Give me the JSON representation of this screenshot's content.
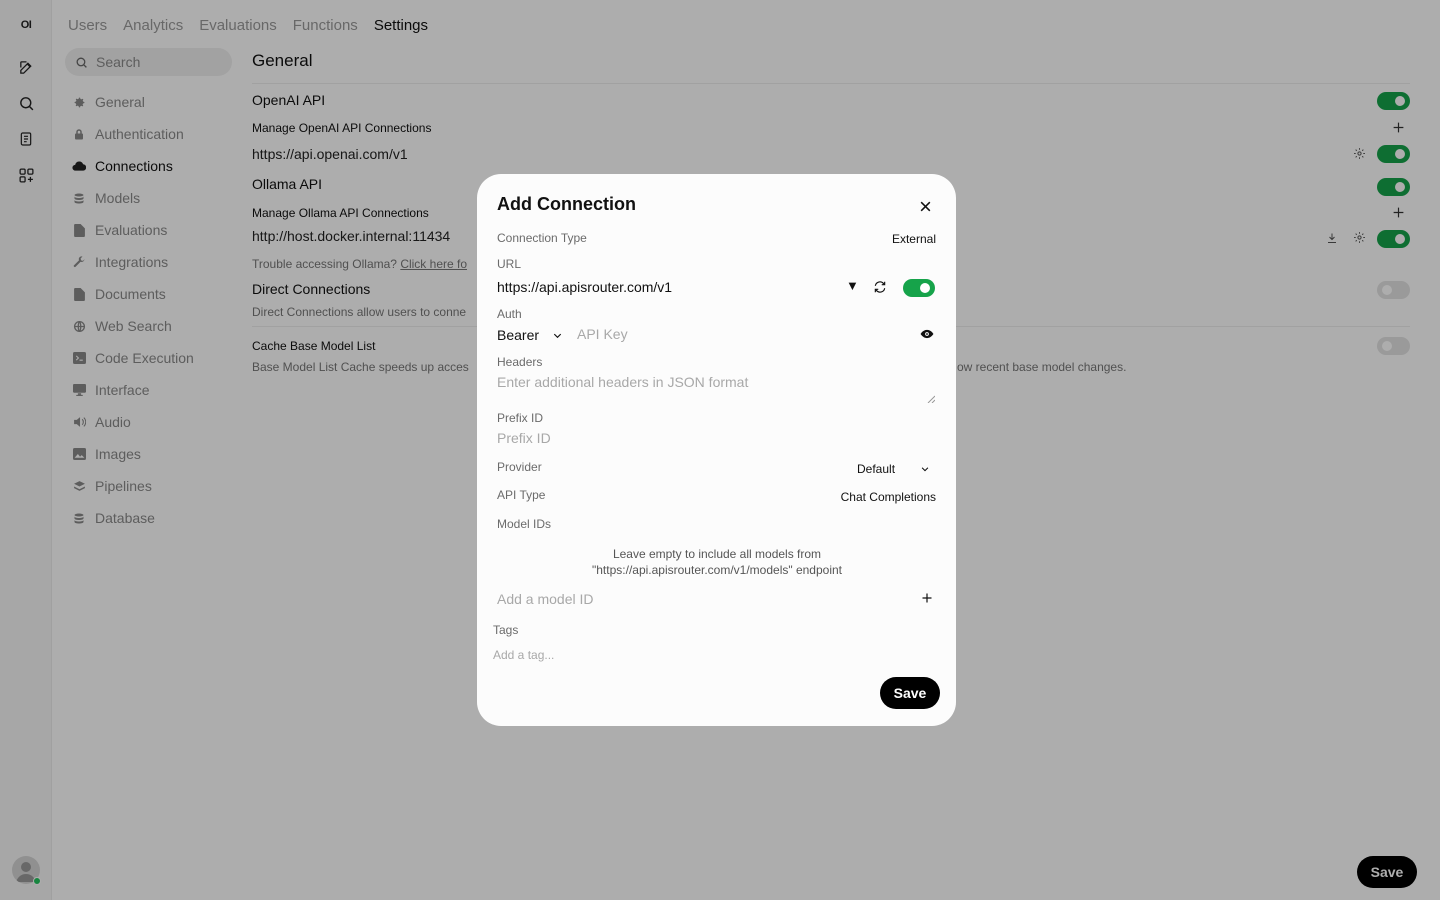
{
  "rail": {
    "logo": "OI",
    "icons": [
      "new-chat-icon",
      "search-icon",
      "notes-icon",
      "workspace-icon"
    ]
  },
  "top_tabs": [
    {
      "label": "Users",
      "active": false
    },
    {
      "label": "Analytics",
      "active": false
    },
    {
      "label": "Evaluations",
      "active": false
    },
    {
      "label": "Functions",
      "active": false
    },
    {
      "label": "Settings",
      "active": true
    }
  ],
  "sidebar": {
    "search_placeholder": "Search",
    "items": [
      {
        "label": "General",
        "icon": "gear-icon",
        "active": false
      },
      {
        "label": "Authentication",
        "icon": "lock-icon",
        "active": false
      },
      {
        "label": "Connections",
        "icon": "cloud-icon",
        "active": true
      },
      {
        "label": "Models",
        "icon": "stack-icon",
        "active": false
      },
      {
        "label": "Evaluations",
        "icon": "document-icon",
        "active": false
      },
      {
        "label": "Integrations",
        "icon": "wrench-icon",
        "active": false
      },
      {
        "label": "Documents",
        "icon": "document-icon",
        "active": false
      },
      {
        "label": "Web Search",
        "icon": "globe-icon",
        "active": false
      },
      {
        "label": "Code Execution",
        "icon": "terminal-icon",
        "active": false
      },
      {
        "label": "Interface",
        "icon": "monitor-icon",
        "active": false
      },
      {
        "label": "Audio",
        "icon": "speaker-icon",
        "active": false
      },
      {
        "label": "Images",
        "icon": "image-icon",
        "active": false
      },
      {
        "label": "Pipelines",
        "icon": "layers-icon",
        "active": false
      },
      {
        "label": "Database",
        "icon": "database-icon",
        "active": false
      }
    ]
  },
  "main": {
    "title": "General",
    "openai": {
      "title": "OpenAI API",
      "manage_label": "Manage OpenAI API Connections",
      "url": "https://api.openai.com/v1",
      "enabled": true,
      "connection_enabled": true
    },
    "ollama": {
      "title": "Ollama API",
      "manage_label": "Manage Ollama API Connections",
      "url": "http://host.docker.internal:11434",
      "trouble_text": "Trouble accessing Ollama?",
      "trouble_link": "Click here fo",
      "enabled": true,
      "connection_enabled": true
    },
    "direct": {
      "title": "Direct Connections",
      "description": "Direct Connections allow users to conne",
      "enabled": false
    },
    "cache": {
      "title": "Cache Base Model List",
      "description_left": "Base Model List Cache speeds up acces",
      "description_right": "ow recent base model changes.",
      "enabled": false
    },
    "save_label": "Save"
  },
  "modal": {
    "title": "Add Connection",
    "connection_type_label": "Connection Type",
    "connection_type_value": "External",
    "url_label": "URL",
    "url_value": "https://api.apisrouter.com/v1",
    "url_enabled": true,
    "auth_label": "Auth",
    "auth_type": "Bearer",
    "api_key_placeholder": "API Key",
    "headers_label": "Headers",
    "headers_placeholder": "Enter additional headers in JSON format",
    "prefix_label": "Prefix ID",
    "prefix_placeholder": "Prefix ID",
    "provider_label": "Provider",
    "provider_value": "Default",
    "api_type_label": "API Type",
    "api_type_value": "Chat Completions",
    "model_ids_label": "Model IDs",
    "model_ids_note_line1": "Leave empty to include all models from",
    "model_ids_note_line2": "\"https://api.apisrouter.com/v1/models\" endpoint",
    "model_id_placeholder": "Add a model ID",
    "tags_label": "Tags",
    "tags_placeholder": "Add a tag...",
    "save_label": "Save"
  }
}
